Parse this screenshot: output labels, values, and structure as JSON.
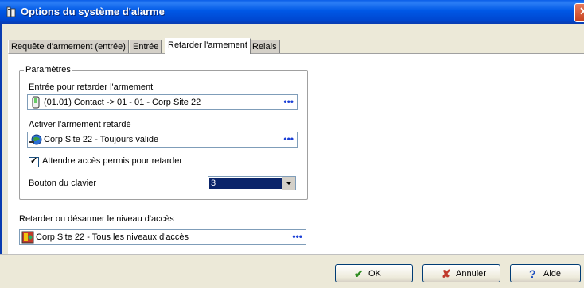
{
  "window": {
    "title": "Options du système d'alarme"
  },
  "tabs": [
    {
      "label": "Requête d'armement (entrée)",
      "active": false
    },
    {
      "label": "Entrée",
      "active": false
    },
    {
      "label": "Retarder l'armement",
      "active": true
    },
    {
      "label": "Relais",
      "active": false
    }
  ],
  "params": {
    "legend": "Paramètres",
    "delay_input_label": "Entrée pour retarder l'armement",
    "delay_input_value": "(01.01) Contact -> 01 - 01 - Corp Site 22",
    "activate_label": "Activer l'armement retardé",
    "activate_value": "Corp Site 22 - Toujours valide",
    "wait_access_label": "Attendre accès permis pour retarder",
    "wait_access_checked": true,
    "keypad_label": "Bouton du clavier",
    "keypad_value": "3"
  },
  "access": {
    "label": "Retarder ou désarmer le niveau d'accès",
    "value": "Corp Site 22 - Tous les niveaux d'accès"
  },
  "browse_dots": "•••",
  "buttons": {
    "ok": "OK",
    "cancel": "Annuler",
    "help": "Aide"
  },
  "icons": {
    "check": "✔",
    "cross": "✘",
    "help": "?"
  },
  "colors": {
    "titlebar": "#0058e6",
    "selection": "#0a246a",
    "browse": "#1a3fd6"
  }
}
